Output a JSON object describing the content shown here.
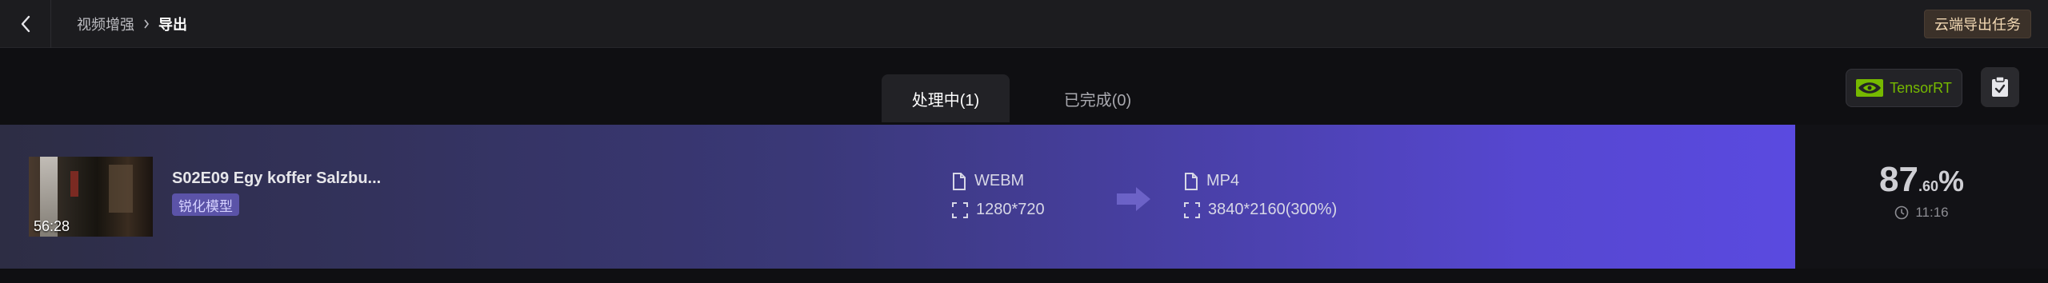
{
  "header": {
    "breadcrumb_parent": "视频增强",
    "breadcrumb_current": "导出",
    "cloud_export_label": "云端导出任务"
  },
  "tabs": [
    {
      "label": "处理中(1)",
      "active": true
    },
    {
      "label": "已完成(0)",
      "active": false
    }
  ],
  "toolbar": {
    "tensorrt_label": "TensorRT"
  },
  "task": {
    "title": "S02E09 Egy koffer Salzbu...",
    "duration": "56:28",
    "model": "锐化模型",
    "source_format": "WEBM",
    "source_resolution": "1280*720",
    "target_format": "MP4",
    "target_resolution": "3840*2160(300%)",
    "progress_int": "87",
    "progress_dec": ".60",
    "progress_sign": "%",
    "progress_fraction": 0.876,
    "eta": "11:16"
  },
  "colors": {
    "accent": "#5a4ae0",
    "nvidia_green": "#76b900",
    "cloud_button_text": "#f3d9b4"
  }
}
